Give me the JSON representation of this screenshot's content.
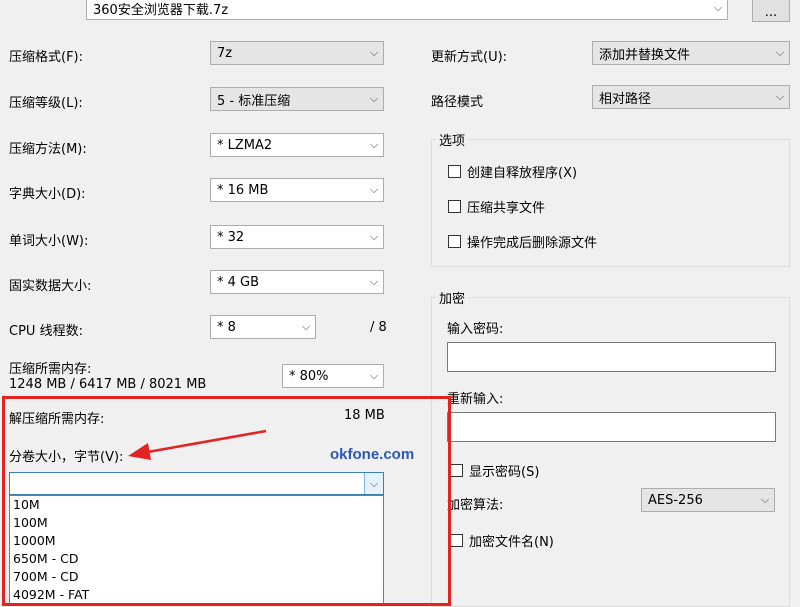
{
  "archive": {
    "path_value": "360安全浏览器下载.7z",
    "browse_label": "..."
  },
  "left": {
    "format_label": "压缩格式(F):",
    "format_value": "7z",
    "level_label": "压缩等级(L):",
    "level_value": "5 - 标准压缩",
    "method_label": "压缩方法(M):",
    "method_value": "* LZMA2",
    "dict_label": "字典大小(D):",
    "dict_value": "* 16 MB",
    "word_label": "单词大小(W):",
    "word_value": "* 32",
    "solid_label": "固实数据大小:",
    "solid_value": "* 4 GB",
    "cpu_label": "CPU 线程数:",
    "cpu_value": "* 8",
    "cpu_total": "/ 8",
    "mem_label": "压缩所需内存:",
    "mem_detail": "1248 MB / 6417 MB / 8021 MB",
    "mem_value": "* 80%",
    "decomp_label": "解压缩所需内存:",
    "decomp_value": "18 MB",
    "split_label": "分卷大小，字节(V):",
    "split_value": "",
    "split_options": [
      "10M",
      "100M",
      "1000M",
      "650M - CD",
      "700M - CD",
      "4092M - FAT"
    ]
  },
  "right": {
    "update_label": "更新方式(U):",
    "update_value": "添加并替换文件",
    "path_mode_label": "路径模式",
    "path_mode_value": "相对路径",
    "options_title": "选项",
    "opt_sfx": "创建自释放程序(X)",
    "opt_shared": "压缩共享文件",
    "opt_delete": "操作完成后删除源文件",
    "enc_title": "加密",
    "pwd_label": "输入密码:",
    "pwd_value": "",
    "repwd_label": "重新输入:",
    "repwd_value": "",
    "show_pwd": "显示密码(S)",
    "enc_method_label": "加密算法:",
    "enc_method_value": "AES-256",
    "enc_names": "加密文件名(N)"
  },
  "watermark": "okfone.com",
  "annotation": {
    "box_color": "#e32222",
    "arrow_color": "#e32222"
  }
}
